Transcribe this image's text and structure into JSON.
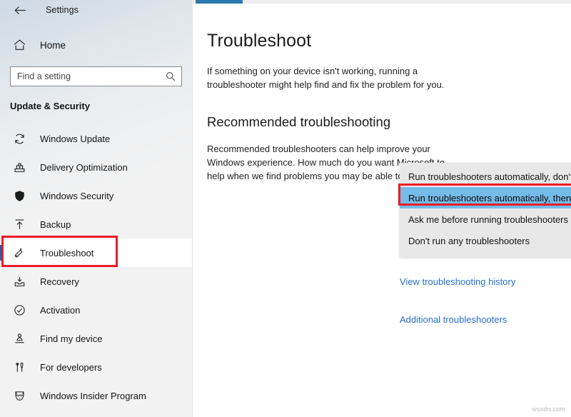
{
  "window": {
    "app_title": "Settings",
    "back_icon": "back-arrow-icon"
  },
  "sidebar": {
    "home": {
      "label": "Home",
      "icon": "home-icon"
    },
    "search": {
      "placeholder": "Find a setting",
      "value": "",
      "icon": "search-icon"
    },
    "group_title": "Update & Security",
    "items": [
      {
        "label": "Windows Update",
        "icon": "sync-icon",
        "selected": false
      },
      {
        "label": "Delivery Optimization",
        "icon": "delivery-box-icon",
        "selected": false
      },
      {
        "label": "Windows Security",
        "icon": "shield-icon",
        "selected": false
      },
      {
        "label": "Backup",
        "icon": "upload-arrow-icon",
        "selected": false
      },
      {
        "label": "Troubleshoot",
        "icon": "wrench-icon",
        "selected": true
      },
      {
        "label": "Recovery",
        "icon": "recovery-icon",
        "selected": false
      },
      {
        "label": "Activation",
        "icon": "check-circle-icon",
        "selected": false
      },
      {
        "label": "Find my device",
        "icon": "person-locate-icon",
        "selected": false
      },
      {
        "label": "For developers",
        "icon": "tools-icon",
        "selected": false
      },
      {
        "label": "Windows Insider Program",
        "icon": "ninja-cat-icon",
        "selected": false
      }
    ]
  },
  "main": {
    "title": "Troubleshoot",
    "description": "If something on your device isn't working, running a troubleshooter might help find and fix the problem for you.",
    "section": {
      "title": "Recommended troubleshooting",
      "description": "Recommended troubleshooters can help improve your Windows experience. How much do you want Microsoft to help when we find problems you may be able to fix?"
    },
    "dropdown": {
      "options": [
        "Run troubleshooters automatically, don't notify me",
        "Run troubleshooters automatically, then notify me",
        "Ask me before running troubleshooters",
        "Don't run any troubleshooters"
      ],
      "selected_index": 1,
      "selected_value": "Run troubleshooters automatically, then notify me"
    },
    "links": [
      {
        "label": "View troubleshooting history"
      },
      {
        "label": "Additional troubleshooters"
      }
    ]
  },
  "annotations": {
    "color": "#ec1c24",
    "nav_highlight_target": "Troubleshoot",
    "dropdown_highlight_target": "Run troubleshooters automatically, then notify me"
  },
  "colors": {
    "accent": "#0067c0",
    "link": "#2a6fc9",
    "selection": "#75bbe8",
    "annotation": "#ec1c24",
    "tab_indicator": "#2a7ab0"
  },
  "watermark": "wsxdn.com"
}
